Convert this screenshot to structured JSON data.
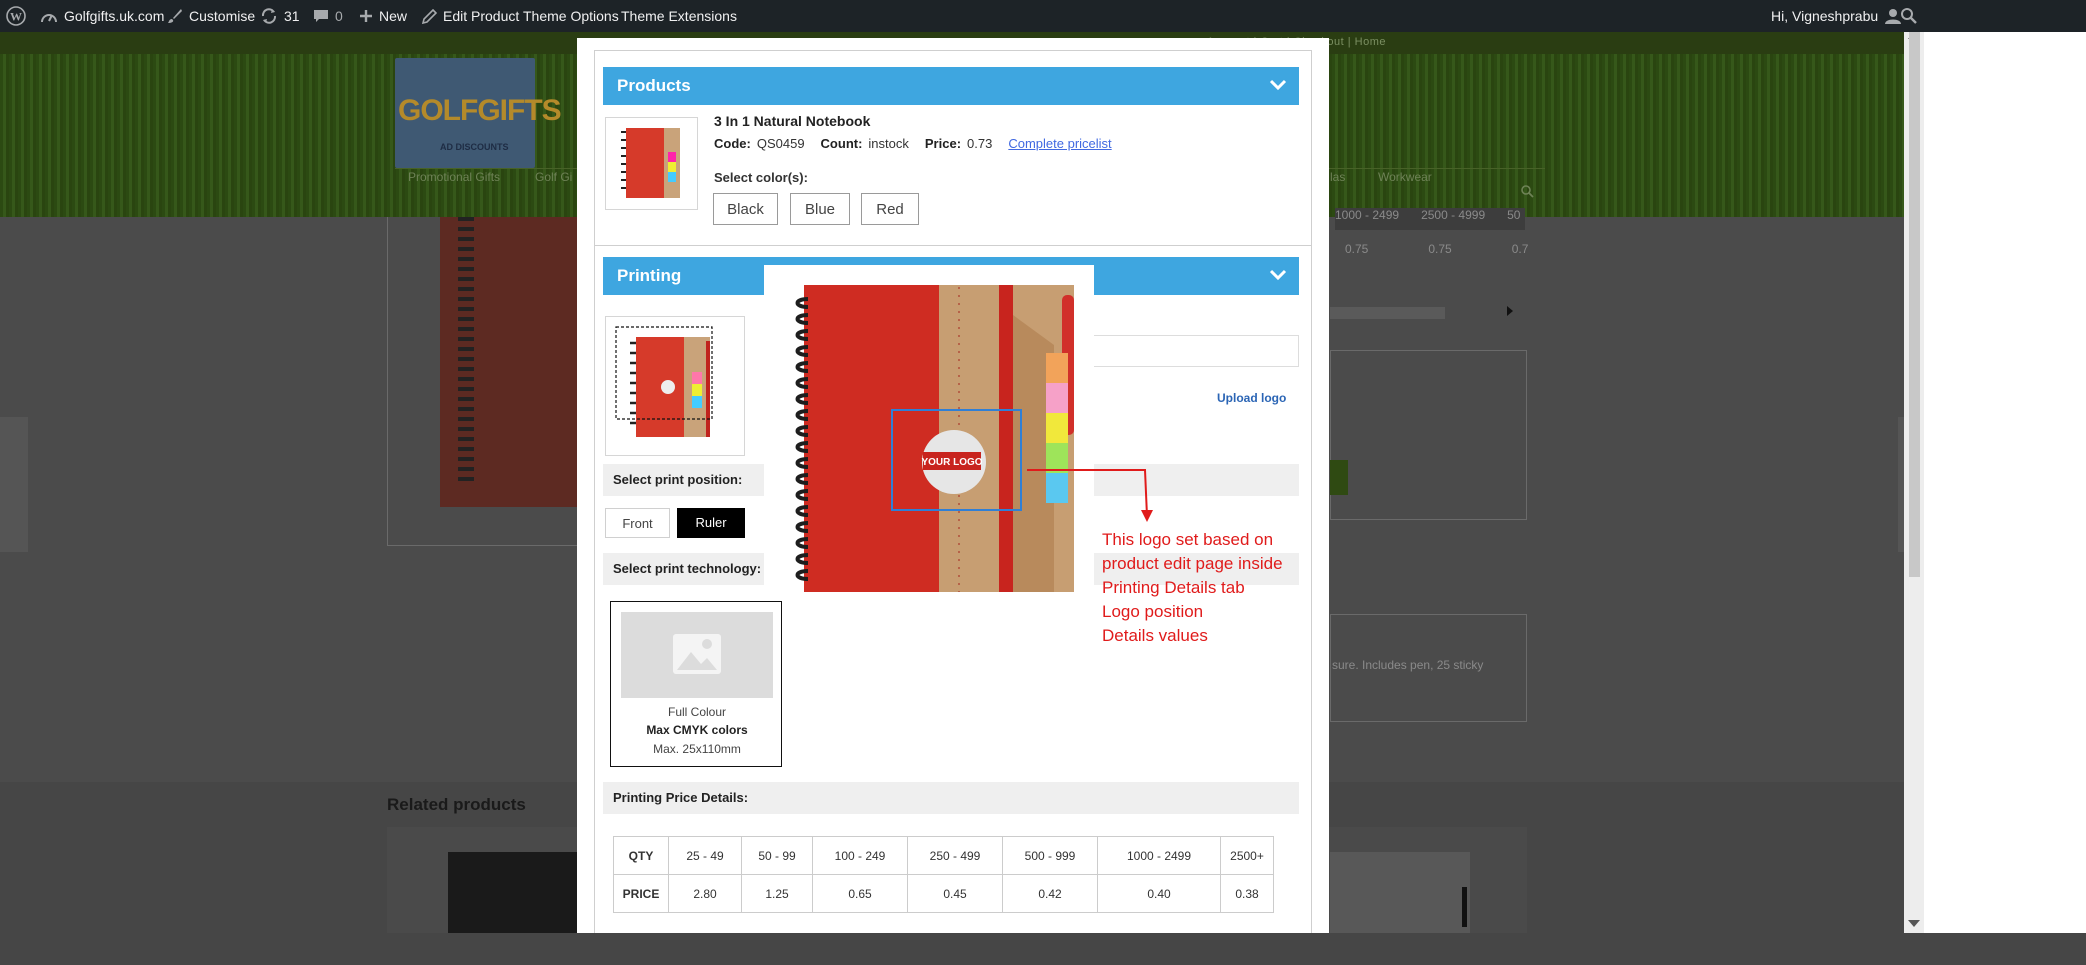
{
  "adminbar": {
    "site_name": "Golfgifts.uk.com",
    "customise": "Customise",
    "updates_count": "31",
    "comments_count": "0",
    "new": "New",
    "edit_product": "Edit Product",
    "theme_options": "Theme Options",
    "theme_extensions": "Theme Extensions",
    "greeting": "Hi, Vigneshprabu"
  },
  "background": {
    "topnav": "Account | Cart | Checkout | Home",
    "logo_main": "GOLFGIFTS",
    "logo_sub": "AD DISCOUNTS",
    "nav_promotional": "Promotional Gifts",
    "nav_golf": "Golf Gi",
    "nav_las": "las",
    "nav_workwear": "Workwear",
    "table_headers": [
      "1000 - 2499",
      "2500 - 4999",
      "50"
    ],
    "table_values": [
      "0.75",
      "0.75",
      "0.7"
    ],
    "desc_fragment": "sure. Includes pen, 25 sticky",
    "related_products": "Related products"
  },
  "products": {
    "section_title": "Products",
    "product_name": "3 In 1 Natural Notebook",
    "code_label": "Code:",
    "code_value": "QS0459",
    "count_label": "Count:",
    "count_value": "instock",
    "price_label": "Price:",
    "price_value": "0.73",
    "pricelist_link": "Complete pricelist",
    "select_colors_label": "Select color(s):",
    "colors": [
      "Black",
      "Blue",
      "Red"
    ]
  },
  "printing": {
    "section_title": "Printing",
    "upload_logo": "Upload logo",
    "print_position_label": "Select print position:",
    "positions": [
      "Front",
      "Ruler"
    ],
    "selected_position": "Ruler",
    "print_technology_label": "Select print technology:",
    "technology": {
      "name": "Full Colour",
      "colors": "Max CMYK colors",
      "max_size": "Max. 25x110mm"
    },
    "logo_overlay_text": "YOUR LOGO",
    "annotation_lines": [
      "This logo set based on",
      "product edit page inside",
      "Printing Details tab",
      "Logo position",
      "Details values"
    ],
    "price_details_label": "Printing Price Details:",
    "price_table": {
      "qty_label": "QTY",
      "price_label": "PRICE",
      "ranges": [
        "25 - 49",
        "50 - 99",
        "100 - 249",
        "250 - 499",
        "500 - 999",
        "1000 - 2499",
        "2500+"
      ],
      "prices": [
        "2.80",
        "1.25",
        "0.65",
        "0.45",
        "0.42",
        "0.40",
        "0.38"
      ]
    }
  },
  "colors": {
    "accent_blue": "#3ea6e0",
    "annotation_red": "#e01b1b",
    "adminbar": "#1d2327",
    "link_blue": "#4169e1"
  }
}
